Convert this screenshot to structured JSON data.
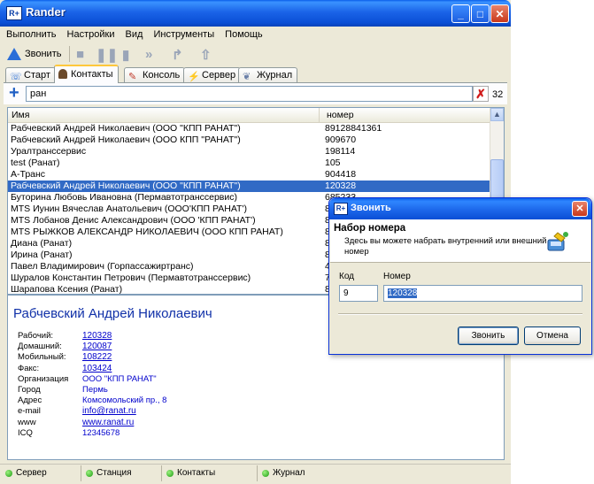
{
  "app": {
    "title": "Rander"
  },
  "menu": [
    "Выполнить",
    "Настройки",
    "Вид",
    "Инструменты",
    "Помощь"
  ],
  "toolbar": {
    "call_label": "Звонить"
  },
  "tabs": [
    {
      "label": "Старт",
      "icon": "phone-icon"
    },
    {
      "label": "Контакты",
      "icon": "contacts-icon",
      "active": true
    },
    {
      "label": "Консоль",
      "icon": "console-icon"
    },
    {
      "label": "Сервер",
      "icon": "server-icon"
    },
    {
      "label": "Журнал",
      "icon": "journal-icon"
    }
  ],
  "search": {
    "value": "ран",
    "count": "32"
  },
  "grid": {
    "columns": [
      "Имя",
      "номер"
    ],
    "rows": [
      [
        "Рабчевский Андрей Николаевич (ООО \"КПП РАНАТ\")",
        "89128841361"
      ],
      [
        "Рабчевский Андрей  Николаевич (ООО КПП \"РАНАТ\")",
        "909670"
      ],
      [
        "Уралтранссервис",
        "198114"
      ],
      [
        "test (Ранат)",
        "105"
      ],
      [
        "А-Транс",
        "904418"
      ],
      [
        "Рабчевский Андрей Николаевич (ООО \"КПП РАНАТ\")",
        "120328"
      ],
      [
        "Буторина Любовь Ивановна (Пермавтотранссервис)",
        "685233"
      ],
      [
        "MTS Иунин Вячеслав Анатольевич (ООО'КПП РАНАТ')",
        "8"
      ],
      [
        "MTS Лобанов Денис Александрович (ООО 'КПП РАНАТ')",
        "8"
      ],
      [
        "MTS РЫЖКОВ  АЛЕКСАНДР НИКОЛАЕВИЧ (ООО КПП РАНАТ)",
        "8"
      ],
      [
        "Диана (Ранат)",
        "8"
      ],
      [
        "Ирина (Ранат)",
        "8"
      ],
      [
        "Павел Владимирович (Горпассажиртранс)",
        "4"
      ],
      [
        "Шуралов Константин Петрович (Пермавтотранссервис)",
        "7"
      ],
      [
        "Шарапова Ксения (Ранат)",
        "8"
      ]
    ],
    "selected_index": 5
  },
  "details": {
    "name": "Рабчевский Андрей Николаевич",
    "fields": [
      {
        "label": "Рабочий:",
        "value": "120328",
        "link": true
      },
      {
        "label": "Домашний:",
        "value": "120087",
        "link": true
      },
      {
        "label": "Мобильный:",
        "value": "108222",
        "link": true
      },
      {
        "label": "Факс:",
        "value": "103424",
        "link": true
      },
      {
        "label": "Организация",
        "value": "ООО \"КПП РАНАТ\"",
        "link": false
      },
      {
        "label": "Город",
        "value": "Пермь",
        "link": false
      },
      {
        "label": "Адрес",
        "value": "Комсомольский пр., 8",
        "link": false
      },
      {
        "label": "e-mail",
        "value": "info@ranat.ru",
        "link": true
      },
      {
        "label": "www",
        "value": "www.ranat.ru",
        "link": true
      },
      {
        "label": "ICQ",
        "value": "12345678",
        "link": false
      }
    ]
  },
  "status": [
    "Сервер",
    "Станция",
    "Контакты",
    "Журнал"
  ],
  "dialog": {
    "title": "Звонить",
    "heading": "Набор номера",
    "subtitle": "Здесь вы можете набрать внутренний или внешний номер",
    "code_label": "Код",
    "number_label": "Номер",
    "code_value": "9",
    "number_value": "120328",
    "call_button": "Звонить",
    "cancel_button": "Отмена"
  },
  "colors": {
    "selection": "#316ac5",
    "title_bar": "#0a5ee9",
    "link": "#0000cc",
    "detail_name": "#1030a8"
  }
}
